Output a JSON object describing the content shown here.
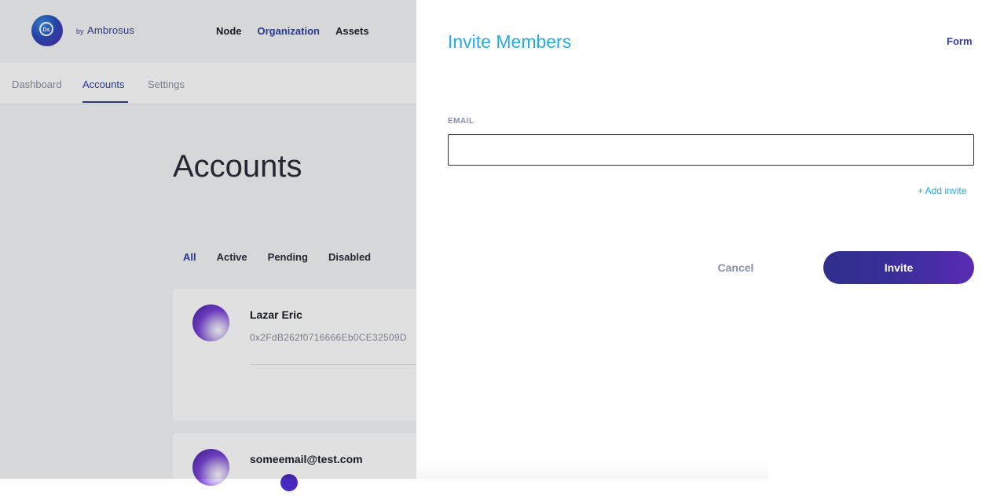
{
  "brand": {
    "logo_text": "Ds",
    "by": "by",
    "name": "Ambrosus"
  },
  "topnav": {
    "items": [
      {
        "label": "Node",
        "active": false
      },
      {
        "label": "Organization",
        "active": true
      },
      {
        "label": "Assets",
        "active": false
      }
    ]
  },
  "subnav": {
    "tabs": [
      {
        "label": "Dashboard",
        "active": false
      },
      {
        "label": "Accounts",
        "active": true
      },
      {
        "label": "Settings",
        "active": false
      }
    ]
  },
  "page": {
    "title": "Accounts",
    "filters": [
      {
        "label": "All",
        "active": true
      },
      {
        "label": "Active",
        "active": false
      },
      {
        "label": "Pending",
        "active": false
      },
      {
        "label": "Disabled",
        "active": false
      }
    ],
    "accounts": [
      {
        "name": "Lazar Eric",
        "address": "0x2FdB262f0716666Eb0CE32509D"
      },
      {
        "name": "someemail@test.com"
      }
    ]
  },
  "panel": {
    "title": "Invite Members",
    "form_link": "Form",
    "email_label": "EMAIL",
    "email_value": "",
    "email_placeholder": "",
    "add_invite": "+ Add invite",
    "cancel_label": "Cancel",
    "invite_label": "Invite"
  },
  "colors": {
    "accent_blue": "#27a9e1",
    "brand_navy": "#2f3f9f",
    "invite_gradient_start": "#2f2f8c",
    "invite_gradient_end": "#5a2bb3"
  }
}
